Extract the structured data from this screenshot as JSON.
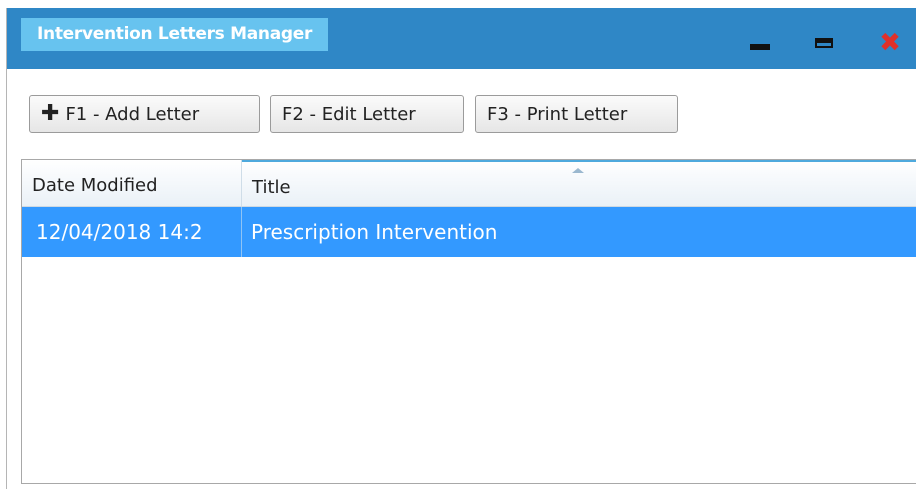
{
  "window": {
    "title": "Intervention Letters Manager",
    "controls": {
      "minimize": "minimize-icon",
      "maximize": "maximize-icon",
      "close": "close-icon"
    }
  },
  "toolbar": {
    "add_label": "F1 - Add Letter",
    "add_icon": "plus-icon",
    "edit_label": "F2 - Edit Letter",
    "print_label": "F3 - Print Letter"
  },
  "grid": {
    "columns": [
      "Date Modified",
      "Title"
    ],
    "sort_column": "Title",
    "sort_direction": "ascending",
    "rows": [
      {
        "date_modified": "12/04/2018 14:2",
        "title": "Prescription Intervention",
        "selected": true
      }
    ]
  },
  "colors": {
    "titlebar": "#2f87c6",
    "title_tab": "#67c3ef",
    "selection": "#3399ff",
    "close": "#e0302a"
  }
}
